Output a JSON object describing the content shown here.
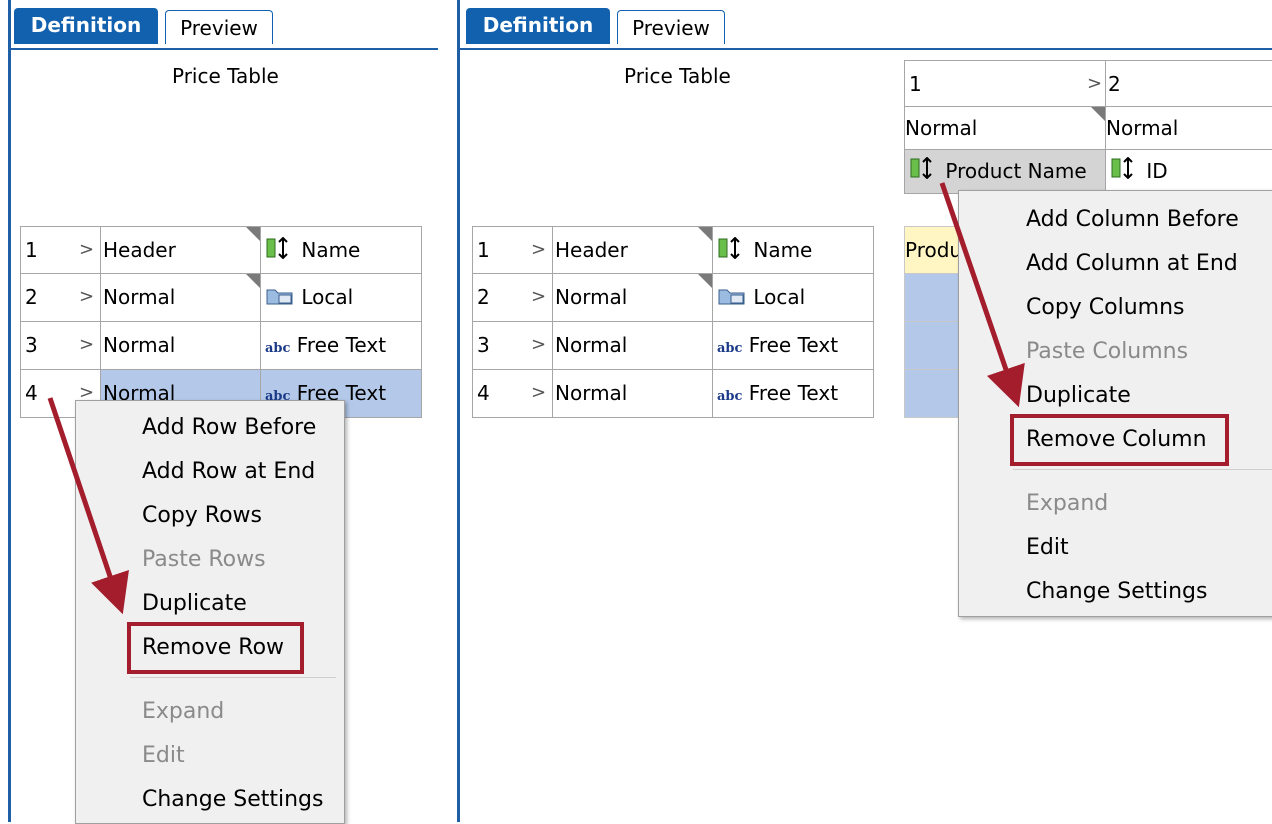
{
  "left": {
    "tabs": [
      "Definition",
      "Preview"
    ],
    "title": "Price Table",
    "rows": [
      {
        "num": "1",
        "style": "Header",
        "icon": "column-resize-icon",
        "value": "Name"
      },
      {
        "num": "2",
        "style": "Normal",
        "icon": "folder-link-icon",
        "value": "Local"
      },
      {
        "num": "3",
        "style": "Normal",
        "icon": "abc-text-icon",
        "value": "Free Text"
      },
      {
        "num": "4",
        "style": "Normal",
        "icon": "abc-text-icon",
        "value": "Free Text"
      }
    ],
    "menu": {
      "items": [
        "Add Row Before",
        "Add Row at End",
        "Copy Rows",
        "Paste Rows",
        "Duplicate",
        "Remove Row",
        "Expand",
        "Edit",
        "Change Settings"
      ],
      "disabled": [
        "Paste Rows",
        "Expand",
        "Edit"
      ],
      "highlighted": "Remove Row"
    }
  },
  "right": {
    "tabs": [
      "Definition",
      "Preview"
    ],
    "title": "Price Table",
    "col_headers": [
      {
        "num": "1",
        "style": "Normal",
        "icon": "column-resize-icon",
        "value": "Product Name"
      },
      {
        "num": "2",
        "style": "Normal",
        "icon": "column-resize-icon",
        "value": "ID"
      }
    ],
    "rows": [
      {
        "num": "1",
        "style": "Header",
        "icon": "column-resize-icon",
        "value": "Name"
      },
      {
        "num": "2",
        "style": "Normal",
        "icon": "folder-link-icon",
        "value": "Local"
      },
      {
        "num": "3",
        "style": "Normal",
        "icon": "abc-text-icon",
        "value": "Free Text"
      },
      {
        "num": "4",
        "style": "Normal",
        "icon": "abc-text-icon",
        "value": "Free Text"
      }
    ],
    "partial_cell": "Produ",
    "menu": {
      "items": [
        "Add Column Before",
        "Add Column at End",
        "Copy Columns",
        "Paste Columns",
        "Duplicate",
        "Remove Column",
        "Expand",
        "Edit",
        "Change Settings"
      ],
      "disabled": [
        "Paste Columns",
        "Expand"
      ],
      "highlighted": "Remove Column"
    }
  },
  "colors": {
    "accent": "#1261ae",
    "highlight_box": "#a31d2d",
    "selection": "#b4c9ea"
  }
}
